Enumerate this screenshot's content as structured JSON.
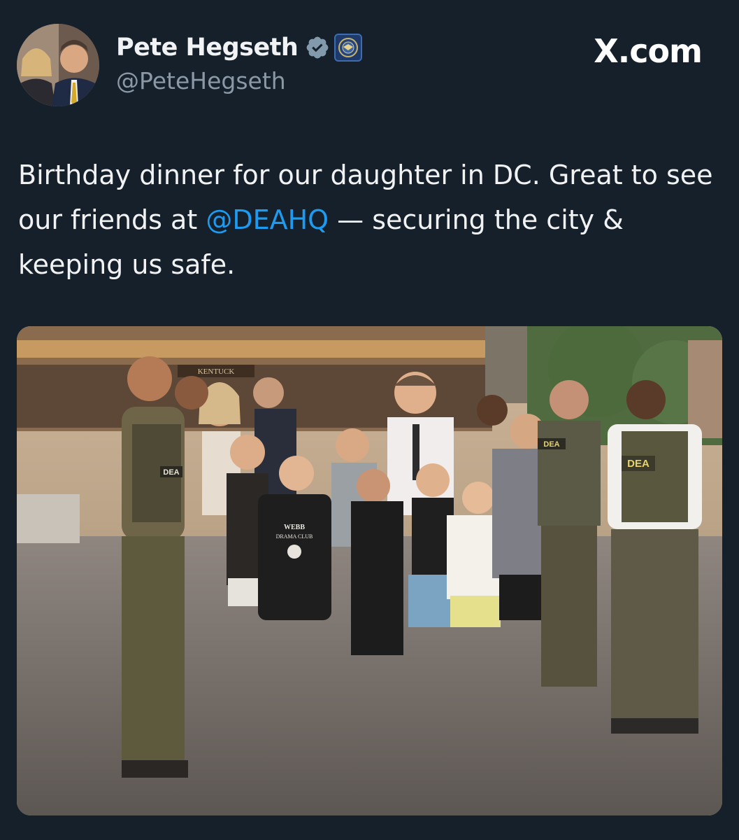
{
  "author": {
    "display_name": "Pete Hegseth",
    "handle": "@PeteHegseth",
    "verified_icon": "verified-badge-icon",
    "affiliation_icon": "dod-seal-icon"
  },
  "site_logo": "X.com",
  "tweet": {
    "text_part1": "Birthday dinner for our daughter in DC. Great to see our friends at ",
    "mention": "@DEAHQ",
    "text_part2": " — securing the city & keeping us safe."
  },
  "photo": {
    "vest_labels": [
      "DEA",
      "DEA",
      "DEA"
    ],
    "shirt_text_line1": "WEBB",
    "shirt_text_line2": "DRAMA CLUB",
    "building_sign": "KENTUCK"
  },
  "colors": {
    "background": "#15202b",
    "mention": "#1d9bf0",
    "verified": "#829aab",
    "handle": "#8b98a5"
  }
}
